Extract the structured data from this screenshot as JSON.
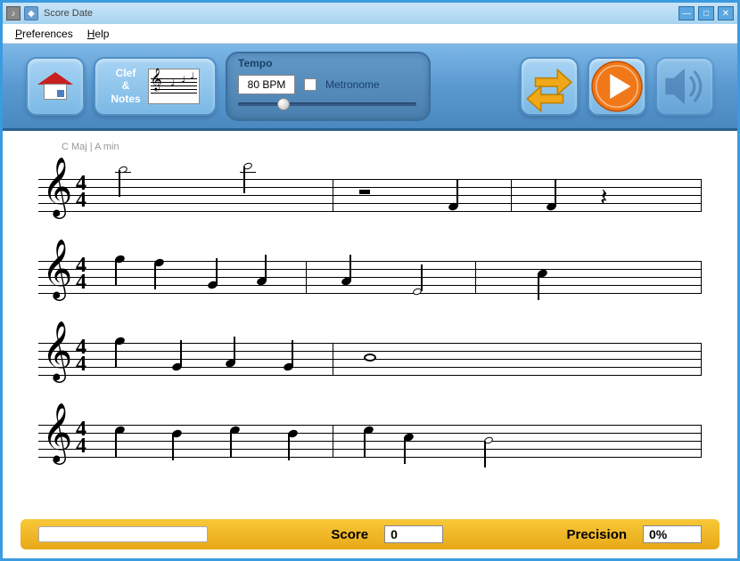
{
  "window": {
    "title": "Score Date"
  },
  "menu": {
    "preferences": "Preferences",
    "help": "Help"
  },
  "toolbar": {
    "clef_notes_label": "Clef\n&\nNotes",
    "tempo_label": "Tempo",
    "tempo_value": "80 BPM",
    "metronome_label": "Metronome"
  },
  "score": {
    "key_label": "C Maj | A min",
    "timesig_top": "4",
    "timesig_bottom": "4"
  },
  "bottom": {
    "score_label": "Score",
    "score_value": "0",
    "precision_label": "Precision",
    "precision_value": "0%"
  }
}
